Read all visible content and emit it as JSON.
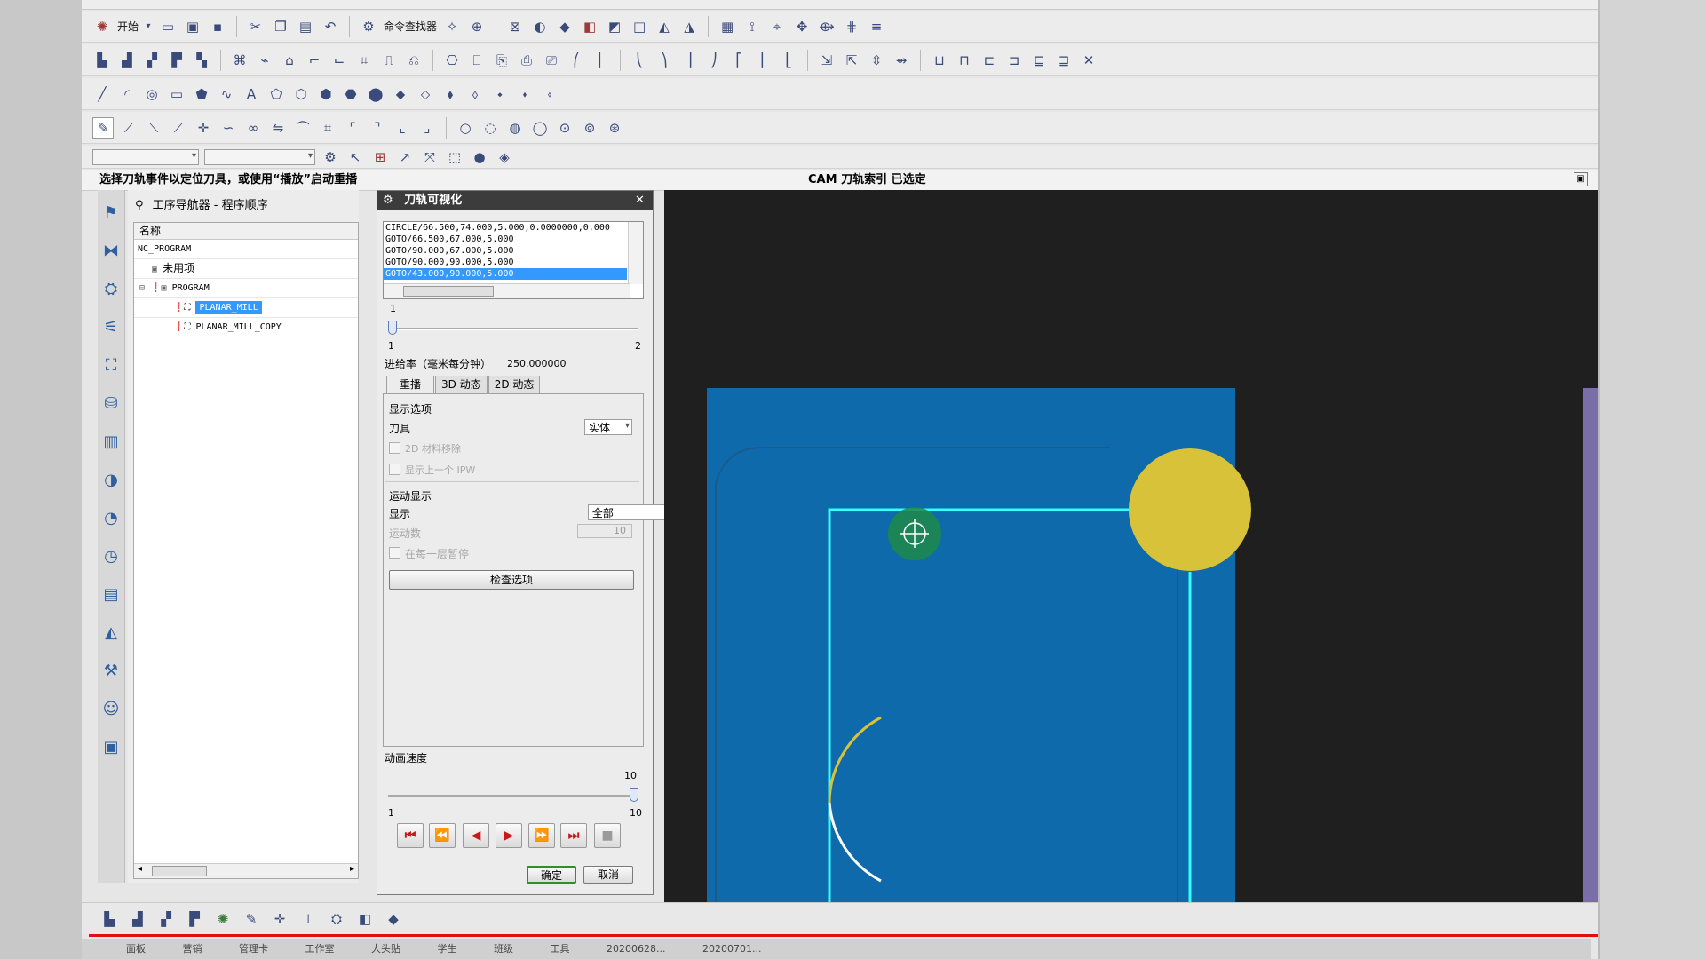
{
  "toolbar": {
    "start_label": "开始",
    "cmd_finder_label": "命令查找器"
  },
  "status": {
    "prompt": "选择刀轨事件以定位刀具，或使用“播放”启动重播",
    "cam_status": "CAM 刀轨索引 已选定"
  },
  "navigator": {
    "title": "工序导航器 - 程序顺序",
    "column_header": "名称",
    "rows": [
      {
        "label": "NC_PROGRAM"
      },
      {
        "label": "未用项"
      },
      {
        "label": "PROGRAM"
      },
      {
        "label": "PLANAR_MILL"
      },
      {
        "label": "PLANAR_MILL_COPY"
      }
    ]
  },
  "dialog": {
    "title": "刀轨可视化",
    "code_lines": [
      "CIRCLE/66.500,74.000,5.000,0.0000000,0.000",
      "GOTO/66.500,67.000,5.000",
      "GOTO/90.000,67.000,5.000",
      "GOTO/90.000,90.000,5.000",
      "GOTO/43.000,90.000,5.000"
    ],
    "slider_top_value": "1",
    "slider_min": "1",
    "slider_max": "2",
    "feedrate_label": "进给率（毫米每分钟）",
    "feedrate_value": "250.000000",
    "tabs": [
      "重播",
      "3D 动态",
      "2D 动态"
    ],
    "display_options_label": "显示选项",
    "tool_label": "刀具",
    "tool_value": "实体",
    "check_2d_material": "2D 材料移除",
    "check_show_prev_ipw": "显示上一个 IPW",
    "motion_display_label": "运动显示",
    "display_label": "显示",
    "display_value": "全部",
    "motion_count_label": "运动数",
    "motion_count_value": "10",
    "check_pause_each_layer": "在每一层暂停",
    "check_options_button": "检查选项",
    "anim_speed_label": "动画速度",
    "speed_value": "10",
    "speed_min": "1",
    "speed_max": "10",
    "ok_label": "确定",
    "cancel_label": "取消"
  },
  "taskbar": {
    "items": [
      "面板",
      "营销",
      "管理卡",
      "工作室",
      "大头贴",
      "学生",
      "班级",
      "工具",
      "20200628...",
      "20200701..."
    ]
  },
  "colors": {
    "viewport_bg": "#1f1f1f",
    "part_blue": "#0e6aaa",
    "toolpath_cyan": "#33ffff",
    "tool_yellow": "#d8c23a",
    "purple_part": "#7a6ea8",
    "selection_blue": "#3399ff"
  },
  "tool_progress_fraction": 0.0,
  "anim_speed_fraction": 1.0
}
